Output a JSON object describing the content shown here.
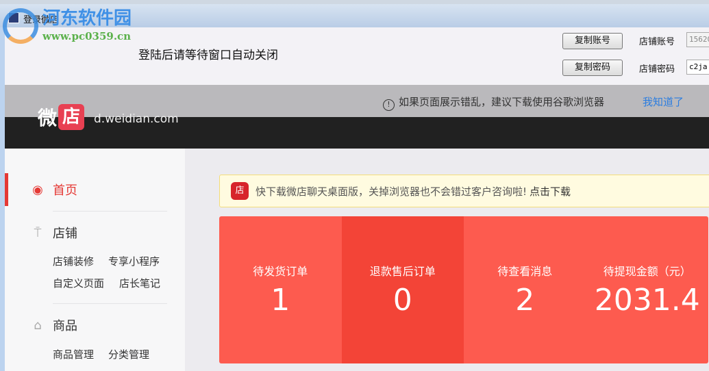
{
  "window": {
    "title": "登录微店"
  },
  "watermark": {
    "name": "河东软件园",
    "url": "www.pc0359.cn"
  },
  "top_panel": {
    "hint": "登陆后请等待窗口自动关闭",
    "copy_account_label": "复制账号",
    "copy_password_label": "复制密码",
    "account_label": "店铺账号",
    "account_value": "15620",
    "password_label": "店铺密码",
    "password_value": "c2ja"
  },
  "notice": {
    "message": "如果页面展示错乱，建议下载使用谷歌浏览器",
    "dismiss": "我知道了",
    "icon": "!"
  },
  "brand": {
    "wei": "微",
    "dian": "店",
    "url": "d.weidian.com"
  },
  "sidebar": {
    "home": "首页",
    "shop": "店铺",
    "shop_sub": [
      "店铺装修",
      "专享小程序",
      "自定义页面",
      "店长笔记"
    ],
    "goods": "商品",
    "goods_sub": [
      "商品管理",
      "分类管理"
    ]
  },
  "banner": {
    "icon": "店",
    "text": "快下载微店聊天桌面版，关掉浏览器也不会错过客户咨询啦!",
    "link": "点击下载"
  },
  "stats": [
    {
      "label": "待发货订单",
      "value": "1"
    },
    {
      "label": "退款售后订单",
      "value": "0"
    },
    {
      "label": "待查看消息",
      "value": "2"
    },
    {
      "label": "待提现金额（元）",
      "value": "2031.4"
    }
  ]
}
